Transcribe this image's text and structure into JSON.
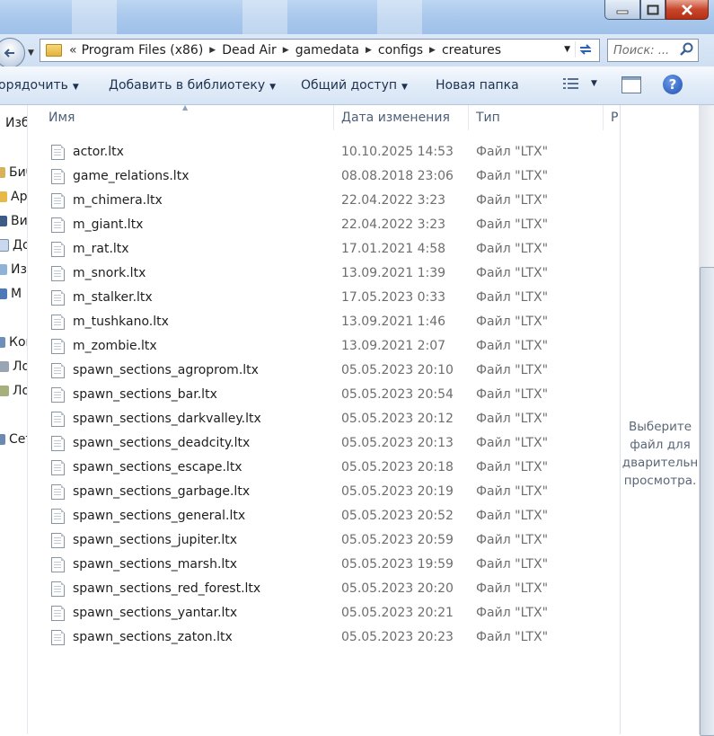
{
  "address": {
    "chevron": "«",
    "crumbs": [
      "Program Files (x86)",
      "Dead Air",
      "gamedata",
      "configs",
      "creatures"
    ]
  },
  "search": {
    "placeholder": "Поиск: ..."
  },
  "toolbar": {
    "organize": "орядочить",
    "add_library": "Добавить в библиотеку",
    "share": "Общий доступ",
    "new_folder": "Новая папка"
  },
  "nav_pane": {
    "items": [
      {
        "label": "Изб",
        "icon": "star-icon"
      },
      {
        "label": "Биб",
        "icon": "library-icon"
      },
      {
        "label": "Ар",
        "icon": "folder-icon"
      },
      {
        "label": "Ви",
        "icon": "video-icon"
      },
      {
        "label": "До",
        "icon": "documents-icon"
      },
      {
        "label": "Из",
        "icon": "pictures-icon"
      },
      {
        "label": "М",
        "icon": "music-icon"
      },
      {
        "label": "Ком",
        "icon": "computer-icon"
      },
      {
        "label": "Ло",
        "icon": "disk-icon"
      },
      {
        "label": "Ло",
        "icon": "disk-icon"
      },
      {
        "label": "Сет",
        "icon": "network-icon"
      }
    ]
  },
  "columns": {
    "name": "Имя",
    "date": "Дата изменения",
    "type": "Тип",
    "size": "Р"
  },
  "files": [
    {
      "name": "actor.ltx",
      "date": "10.10.2025 14:53",
      "type": "Файл \"LTX\""
    },
    {
      "name": "game_relations.ltx",
      "date": "08.08.2018 23:06",
      "type": "Файл \"LTX\""
    },
    {
      "name": "m_chimera.ltx",
      "date": "22.04.2022 3:23",
      "type": "Файл \"LTX\""
    },
    {
      "name": "m_giant.ltx",
      "date": "22.04.2022 3:23",
      "type": "Файл \"LTX\""
    },
    {
      "name": "m_rat.ltx",
      "date": "17.01.2021 4:58",
      "type": "Файл \"LTX\""
    },
    {
      "name": "m_snork.ltx",
      "date": "13.09.2021 1:39",
      "type": "Файл \"LTX\""
    },
    {
      "name": "m_stalker.ltx",
      "date": "17.05.2023 0:33",
      "type": "Файл \"LTX\""
    },
    {
      "name": "m_tushkano.ltx",
      "date": "13.09.2021 1:46",
      "type": "Файл \"LTX\""
    },
    {
      "name": "m_zombie.ltx",
      "date": "13.09.2021 2:07",
      "type": "Файл \"LTX\""
    },
    {
      "name": "spawn_sections_agroprom.ltx",
      "date": "05.05.2023 20:10",
      "type": "Файл \"LTX\""
    },
    {
      "name": "spawn_sections_bar.ltx",
      "date": "05.05.2023 20:54",
      "type": "Файл \"LTX\""
    },
    {
      "name": "spawn_sections_darkvalley.ltx",
      "date": "05.05.2023 20:12",
      "type": "Файл \"LTX\""
    },
    {
      "name": "spawn_sections_deadcity.ltx",
      "date": "05.05.2023 20:13",
      "type": "Файл \"LTX\""
    },
    {
      "name": "spawn_sections_escape.ltx",
      "date": "05.05.2023 20:18",
      "type": "Файл \"LTX\""
    },
    {
      "name": "spawn_sections_garbage.ltx",
      "date": "05.05.2023 20:19",
      "type": "Файл \"LTX\""
    },
    {
      "name": "spawn_sections_general.ltx",
      "date": "05.05.2023 20:52",
      "type": "Файл \"LTX\""
    },
    {
      "name": "spawn_sections_jupiter.ltx",
      "date": "05.05.2023 20:59",
      "type": "Файл \"LTX\""
    },
    {
      "name": "spawn_sections_marsh.ltx",
      "date": "05.05.2023 19:59",
      "type": "Файл \"LTX\""
    },
    {
      "name": "spawn_sections_red_forest.ltx",
      "date": "05.05.2023 20:20",
      "type": "Файл \"LTX\""
    },
    {
      "name": "spawn_sections_yantar.ltx",
      "date": "05.05.2023 20:21",
      "type": "Файл \"LTX\""
    },
    {
      "name": "spawn_sections_zaton.ltx",
      "date": "05.05.2023 20:23",
      "type": "Файл \"LTX\""
    }
  ],
  "preview": {
    "lines": [
      "Выберите",
      "файл для",
      "дварительн",
      "просмотра."
    ]
  },
  "colors": {
    "titlebar": "#a9c8ec",
    "toolbar": "#e2ecf8",
    "close_button": "#c8462b",
    "secondary_text": "#6d6d6d"
  }
}
